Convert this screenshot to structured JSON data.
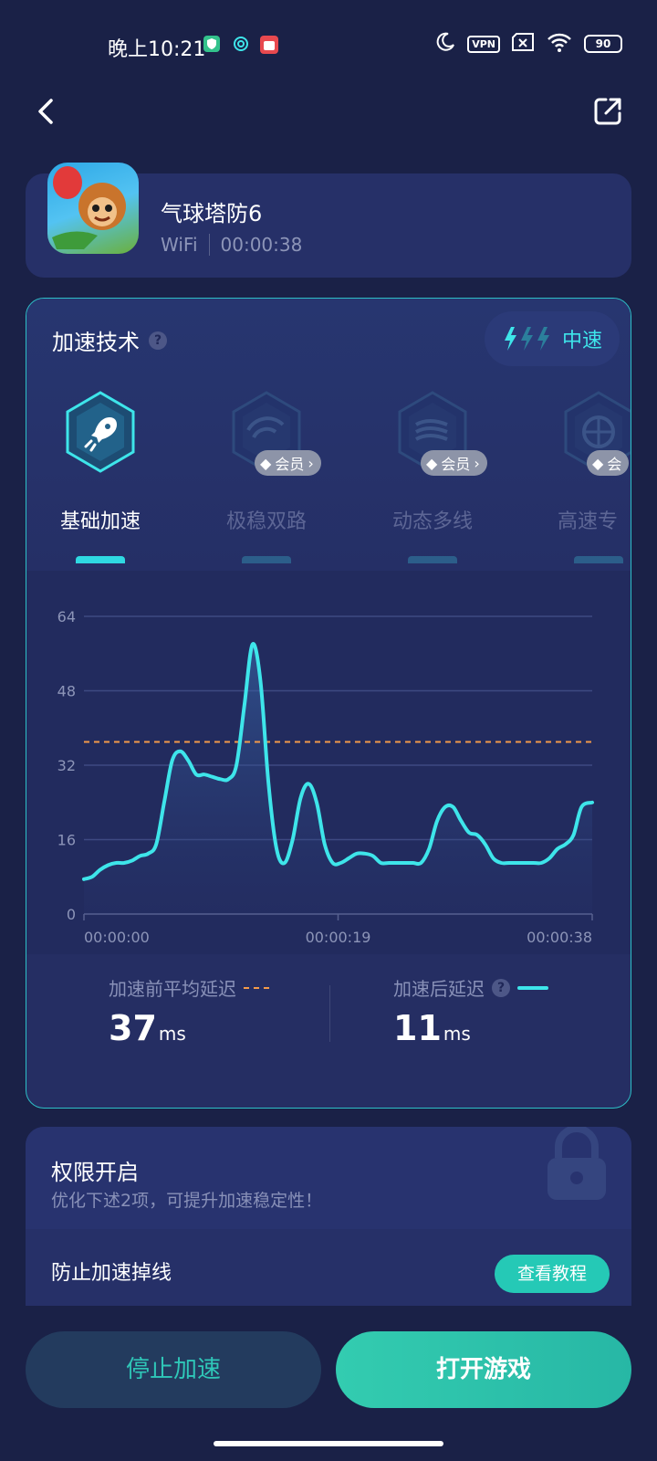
{
  "status_bar": {
    "time": "晚上10:21",
    "vpn": "VPN",
    "battery": "90"
  },
  "game": {
    "name": "气球塔防6",
    "network": "WiFi",
    "duration": "00:00:38"
  },
  "accel": {
    "title": "加速技术",
    "speed_level": "中速",
    "techs": [
      {
        "label": "基础加速",
        "vip": ""
      },
      {
        "label": "极稳双路",
        "vip": "会员"
      },
      {
        "label": "动态多线",
        "vip": "会员"
      },
      {
        "label": "高速专",
        "vip": "会"
      }
    ]
  },
  "chart_data": {
    "type": "line",
    "x_ticks": [
      "00:00:00",
      "00:00:19",
      "00:00:38"
    ],
    "y_ticks": [
      0,
      16,
      32,
      48,
      64
    ],
    "ylim": [
      0,
      64
    ],
    "xlim": [
      0,
      38
    ],
    "baseline": 37,
    "series": [
      {
        "x": [
          0,
          0.6,
          1.2,
          1.8,
          2.4,
          3.0,
          3.6,
          4.2,
          4.8,
          5.4,
          6.0,
          6.6,
          7.2,
          7.8,
          8.4,
          9.0,
          9.6,
          10.2,
          10.8,
          11.4,
          12.0,
          12.6,
          13.2,
          13.8,
          14.4,
          15.0,
          15.6,
          16.2,
          16.8,
          17.4,
          18.0,
          18.6,
          19.2,
          19.8,
          20.4,
          21.0,
          21.6,
          22.2,
          22.8,
          23.4,
          24.0,
          24.6,
          25.2,
          25.8,
          26.4,
          27.0,
          27.6,
          28.2,
          28.8,
          29.4,
          30.0,
          30.6,
          31.2,
          31.8,
          32.4,
          33.0,
          33.6,
          34.2,
          34.8,
          35.4,
          36.0,
          36.6,
          37.2,
          38.0
        ],
        "y": [
          7.5,
          8,
          9.5,
          10.5,
          11,
          11,
          11.5,
          12.5,
          13,
          15,
          24,
          33,
          35,
          33,
          30,
          30,
          29.5,
          29,
          29,
          32,
          45,
          58,
          50,
          28,
          14,
          11,
          16,
          25,
          28,
          24,
          15,
          11,
          11,
          12,
          13,
          13,
          12.5,
          11,
          11,
          11,
          11,
          11,
          11,
          14,
          20,
          23,
          23,
          20,
          17.5,
          17,
          15,
          12,
          11,
          11,
          11,
          11,
          11,
          11,
          12,
          14,
          15,
          17,
          23,
          24
        ]
      }
    ]
  },
  "stats": {
    "before_label": "加速前平均延迟",
    "before_value": "37",
    "after_label": "加速后延迟",
    "after_value": "11",
    "unit": "ms"
  },
  "permissions": {
    "title": "权限开启",
    "subtitle": "优化下述2项，可提升加速稳定性！",
    "item": "防止加速掉线",
    "tutorial": "查看教程"
  },
  "actions": {
    "stop": "停止加速",
    "open": "打开游戏"
  },
  "colors": {
    "accent": "#3ee5ea",
    "baseline": "#f39a4a",
    "primary_button": "#2ec2ad"
  }
}
